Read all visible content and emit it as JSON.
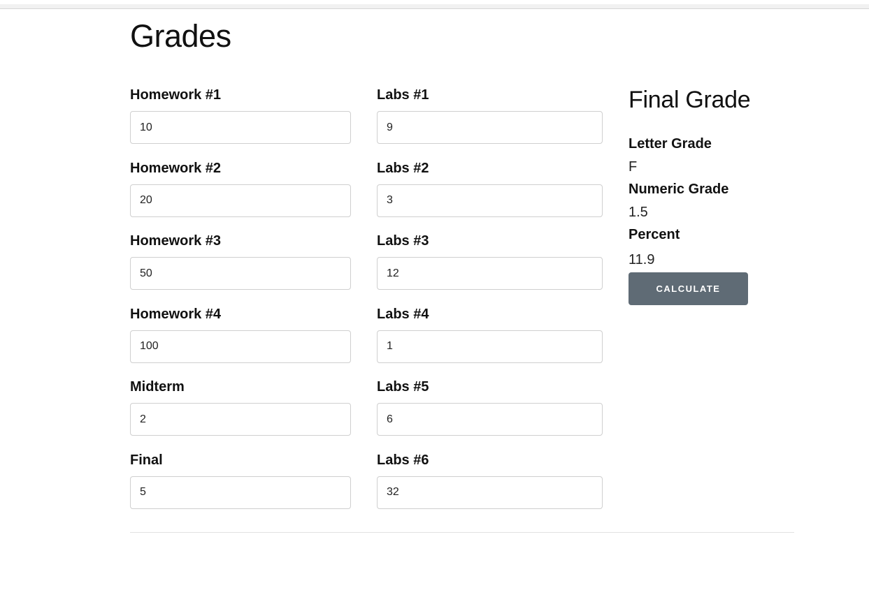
{
  "page_title": "Grades",
  "left_fields": [
    {
      "label": "Homework #1",
      "value": "10"
    },
    {
      "label": "Homework #2",
      "value": "20"
    },
    {
      "label": "Homework #3",
      "value": "50"
    },
    {
      "label": "Homework #4",
      "value": "100"
    },
    {
      "label": "Midterm",
      "value": "2"
    },
    {
      "label": "Final",
      "value": "5"
    }
  ],
  "lab_fields": [
    {
      "label": "Labs #1",
      "value": "9"
    },
    {
      "label": "Labs #2",
      "value": "3"
    },
    {
      "label": "Labs #3",
      "value": "12"
    },
    {
      "label": "Labs #4",
      "value": "1"
    },
    {
      "label": "Labs #5",
      "value": "6"
    },
    {
      "label": "Labs #6",
      "value": "32"
    }
  ],
  "final_grade": {
    "title": "Final Grade",
    "letter_label": "Letter Grade",
    "letter_value": "F",
    "numeric_label": "Numeric Grade",
    "numeric_value": "1.5",
    "percent_label": "Percent",
    "percent_value": "11.9",
    "button_label": "CALCULATE"
  },
  "colors": {
    "button_bg": "#5f6b75",
    "input_border": "#cfcfcf",
    "text": "#111111"
  }
}
